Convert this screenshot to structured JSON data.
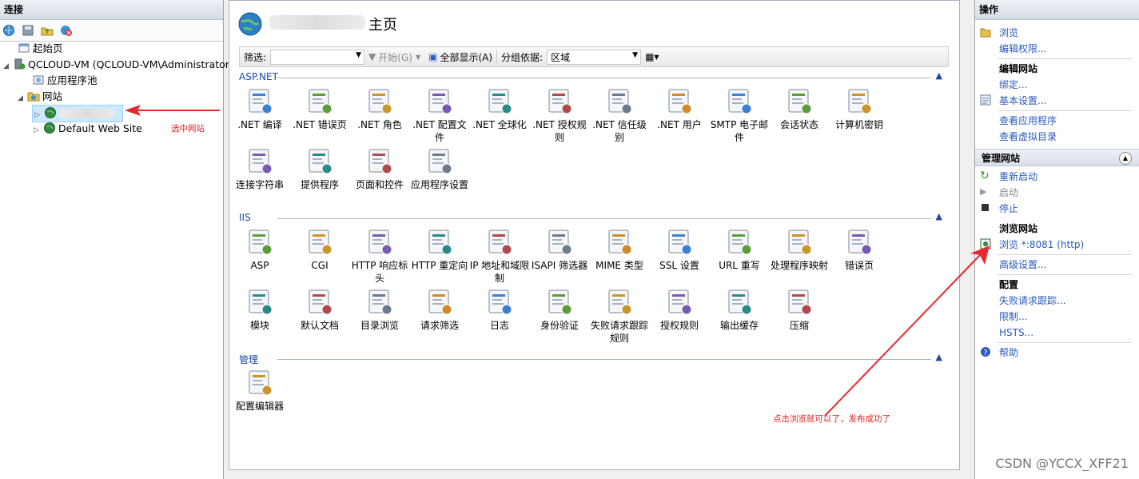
{
  "left": {
    "title": "连接",
    "tree": [
      {
        "label": "起始页"
      },
      {
        "label": "QCLOUD-VM (QCLOUD-VM\\Administrator"
      },
      {
        "label": "应用程序池"
      },
      {
        "label": "网站"
      },
      {
        "label": ""
      },
      {
        "label": "Default Web Site"
      }
    ],
    "annotation": "选中网站"
  },
  "center": {
    "title": "主页",
    "filter": {
      "label": "筛选:",
      "start": "开始(G)",
      "show_all": "全部显示(A)",
      "group_by_label": "分组依据:",
      "group_by_value": "区域"
    },
    "sections": [
      {
        "name": "ASP.NET",
        "features": [
          ".NET 编译",
          ".NET 错误页",
          ".NET 角色",
          ".NET 配置文件",
          ".NET 全球化",
          ".NET 授权规则",
          ".NET 信任级别",
          ".NET 用户",
          "SMTP 电子邮件",
          "会话状态",
          "计算机密钥",
          "连接字符串",
          "提供程序",
          "页面和控件",
          "应用程序设置"
        ]
      },
      {
        "name": "IIS",
        "features": [
          "ASP",
          "CGI",
          "HTTP 响应标头",
          "HTTP 重定向",
          "IP 地址和域限制",
          "ISAPI 筛选器",
          "MIME 类型",
          "SSL 设置",
          "URL 重写",
          "处理程序映射",
          "错误页",
          "模块",
          "默认文档",
          "目录浏览",
          "请求筛选",
          "日志",
          "身份验证",
          "失败请求跟踪规则",
          "授权规则",
          "输出缓存",
          "压缩"
        ]
      },
      {
        "name": "管理",
        "features": [
          "配置编辑器"
        ]
      }
    ]
  },
  "right": {
    "title": "操作",
    "browse": "浏览",
    "edit_perm": "编辑权限...",
    "edit_site": "编辑网站",
    "bindings": "绑定...",
    "basic_settings": "基本设置...",
    "view_apps": "查看应用程序",
    "view_vdirs": "查看虚拟目录",
    "manage_site": "管理网站",
    "restart": "重新启动",
    "start": "启动",
    "stop": "停止",
    "browse_site": "浏览网站",
    "browse_port": "浏览 *:8081 (http)",
    "advanced": "高级设置...",
    "config": "配置",
    "failed_trace": "失败请求跟踪...",
    "limits": "限制...",
    "hsts": "HSTS...",
    "help": "帮助"
  },
  "annotation2": "点击浏览就可以了，发布成功了",
  "watermark": "CSDN @YCCX_XFF21"
}
